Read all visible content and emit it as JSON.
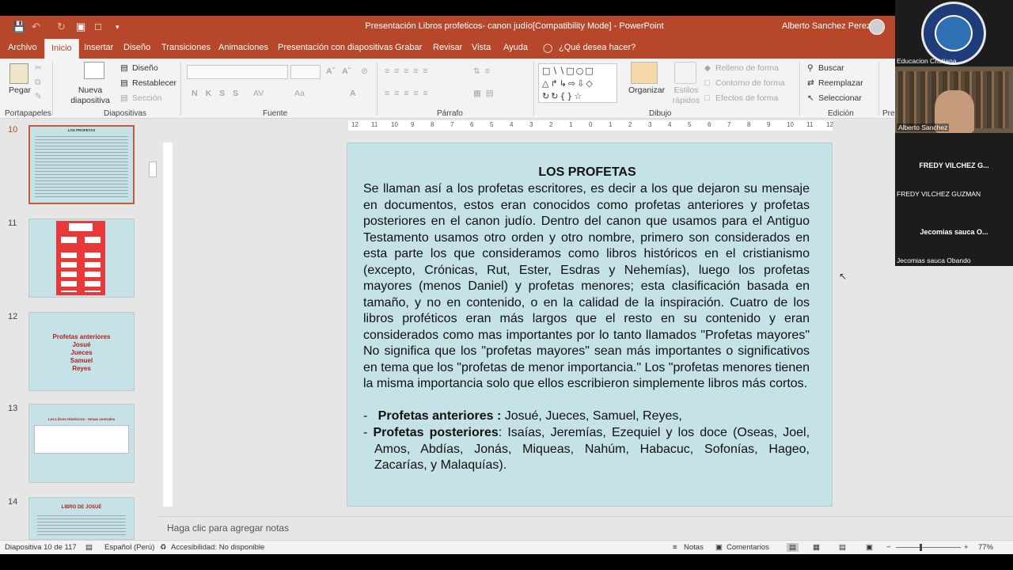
{
  "window": {
    "title": "Presentación Libros profeticos- canon judío[Compatibility Mode]  -  PowerPoint",
    "user": "Alberto Sanchez  Perez"
  },
  "tabs": [
    {
      "label": "Archivo"
    },
    {
      "label": "Inicio",
      "active": true
    },
    {
      "label": "Insertar"
    },
    {
      "label": "Diseño"
    },
    {
      "label": "Transiciones"
    },
    {
      "label": "Animaciones"
    },
    {
      "label": "Presentación con diapositivas"
    },
    {
      "label": "Grabar"
    },
    {
      "label": "Revisar"
    },
    {
      "label": "Vista"
    },
    {
      "label": "Ayuda"
    },
    {
      "label": "¿Qué desea hacer?"
    }
  ],
  "ribbon": {
    "paste": "Pegar",
    "new_slide": "Nueva diapositiva",
    "layout": "Diseño",
    "reset": "Restablecer",
    "section": "Sección",
    "fill": "Relleno de forma",
    "outline": "Contorno de forma",
    "effects": "Efectos de forma",
    "organize": "Organizar",
    "quick_styles": "Estilos rápidos",
    "find": "Buscar",
    "replace": "Reemplazar",
    "select": "Seleccionar",
    "groups": {
      "clipboard": "Portapapeles",
      "slides": "Diapositivas",
      "font": "Fuente",
      "paragraph": "Párrafo",
      "drawing": "Dibujo",
      "editing": "Edición",
      "more": "Pre"
    }
  },
  "thumbnails": [
    {
      "num": "10",
      "selected": true,
      "title": "LOS PROFETAS"
    },
    {
      "num": "11",
      "selected": false
    },
    {
      "num": "12",
      "selected": false,
      "lines": [
        "Profetas anteriores",
        "Josué",
        "Jueces",
        "Samuel",
        "Reyes"
      ]
    },
    {
      "num": "13",
      "selected": false,
      "title": "Los Libros Históricos - temas centrales"
    },
    {
      "num": "14",
      "selected": false,
      "title": "LIBRO DE JOSUÉ"
    }
  ],
  "ruler": {
    "h_ticks": [
      "12",
      "11",
      "10",
      "9",
      "8",
      "7",
      "6",
      "5",
      "4",
      "3",
      "2",
      "1",
      "0",
      "1",
      "2",
      "3",
      "4",
      "5",
      "6",
      "7",
      "8",
      "9",
      "10",
      "11",
      "12"
    ]
  },
  "slide": {
    "title": "LOS PROFETAS",
    "body": "Se llaman así  a los  profetas escritores, es decir a los que dejaron su mensaje en documentos, estos eran conocidos como profetas anteriores y profetas posteriores en el canon judío. Dentro del canon que usamos para el Antiguo Testamento usamos otro orden y otro nombre, primero son considerados en esta parte los que consideramos como libros históricos en el cristianismo  (excepto, Crónicas, Rut, Ester, Esdras y Nehemías), luego los profetas mayores (menos Daniel) y profetas menores; esta clasificación basada en tamaño, y no en contenido, o en la calidad de la inspiración. Cuatro de los libros proféticos eran más largos que el resto en su contenido y eran considerados como mas importantes por lo tanto llamados \"Profetas mayores\"  No significa que los \"profetas mayores\" sean más importantes o significativos en tema que los \"profetas de menor importancia.\"  Los \"profetas  menores tienen la misma importancia solo que ellos  escribieron simplemente libros más cortos.",
    "bullet1_label": "Profetas anteriores :",
    "bullet1_text": " Josué, Jueces, Samuel, Reyes,",
    "bullet2_label": "Profetas posteriores",
    "bullet2_text": ": Isaías, Jeremías, Ezequiel y los doce (Oseas, Joel, Amos, Abdías, Jonás, Miqueas, Nahúm, Habacuc, Sofonías, Hageo, Zacarías, y Malaquías)."
  },
  "notes_placeholder": "Haga clic para agregar notas",
  "status": {
    "slide_counter": "Diapositiva 10 de 117",
    "language": "Español (Perú)",
    "accessibility": "Accesibilidad: No disponible",
    "notes": "Notas",
    "comments": "Comentarios",
    "zoom": "77%"
  },
  "participants": [
    {
      "label": "Educacion Cristiana"
    },
    {
      "label": "Alberto Sanchez"
    },
    {
      "label": "FREDY VILCHEZ G...",
      "name": "FREDY VILCHEZ GUZMAN"
    },
    {
      "label": "Jecomias sauca O...",
      "name": "Jecomias sauca Obando"
    }
  ]
}
